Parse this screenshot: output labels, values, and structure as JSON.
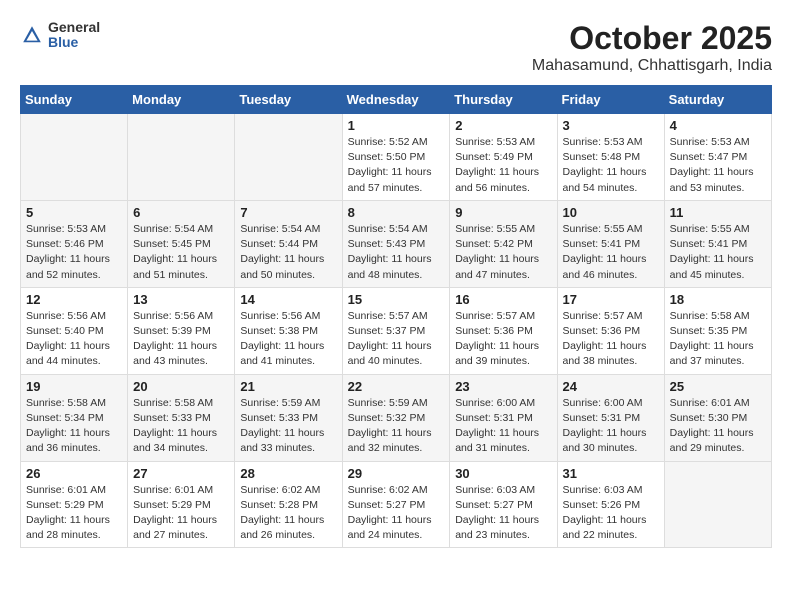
{
  "header": {
    "logo_general": "General",
    "logo_blue": "Blue",
    "month": "October 2025",
    "location": "Mahasamund, Chhattisgarh, India"
  },
  "weekdays": [
    "Sunday",
    "Monday",
    "Tuesday",
    "Wednesday",
    "Thursday",
    "Friday",
    "Saturday"
  ],
  "weeks": [
    [
      {
        "day": "",
        "info": ""
      },
      {
        "day": "",
        "info": ""
      },
      {
        "day": "",
        "info": ""
      },
      {
        "day": "1",
        "info": "Sunrise: 5:52 AM\nSunset: 5:50 PM\nDaylight: 11 hours and 57 minutes."
      },
      {
        "day": "2",
        "info": "Sunrise: 5:53 AM\nSunset: 5:49 PM\nDaylight: 11 hours and 56 minutes."
      },
      {
        "day": "3",
        "info": "Sunrise: 5:53 AM\nSunset: 5:48 PM\nDaylight: 11 hours and 54 minutes."
      },
      {
        "day": "4",
        "info": "Sunrise: 5:53 AM\nSunset: 5:47 PM\nDaylight: 11 hours and 53 minutes."
      }
    ],
    [
      {
        "day": "5",
        "info": "Sunrise: 5:53 AM\nSunset: 5:46 PM\nDaylight: 11 hours and 52 minutes."
      },
      {
        "day": "6",
        "info": "Sunrise: 5:54 AM\nSunset: 5:45 PM\nDaylight: 11 hours and 51 minutes."
      },
      {
        "day": "7",
        "info": "Sunrise: 5:54 AM\nSunset: 5:44 PM\nDaylight: 11 hours and 50 minutes."
      },
      {
        "day": "8",
        "info": "Sunrise: 5:54 AM\nSunset: 5:43 PM\nDaylight: 11 hours and 48 minutes."
      },
      {
        "day": "9",
        "info": "Sunrise: 5:55 AM\nSunset: 5:42 PM\nDaylight: 11 hours and 47 minutes."
      },
      {
        "day": "10",
        "info": "Sunrise: 5:55 AM\nSunset: 5:41 PM\nDaylight: 11 hours and 46 minutes."
      },
      {
        "day": "11",
        "info": "Sunrise: 5:55 AM\nSunset: 5:41 PM\nDaylight: 11 hours and 45 minutes."
      }
    ],
    [
      {
        "day": "12",
        "info": "Sunrise: 5:56 AM\nSunset: 5:40 PM\nDaylight: 11 hours and 44 minutes."
      },
      {
        "day": "13",
        "info": "Sunrise: 5:56 AM\nSunset: 5:39 PM\nDaylight: 11 hours and 43 minutes."
      },
      {
        "day": "14",
        "info": "Sunrise: 5:56 AM\nSunset: 5:38 PM\nDaylight: 11 hours and 41 minutes."
      },
      {
        "day": "15",
        "info": "Sunrise: 5:57 AM\nSunset: 5:37 PM\nDaylight: 11 hours and 40 minutes."
      },
      {
        "day": "16",
        "info": "Sunrise: 5:57 AM\nSunset: 5:36 PM\nDaylight: 11 hours and 39 minutes."
      },
      {
        "day": "17",
        "info": "Sunrise: 5:57 AM\nSunset: 5:36 PM\nDaylight: 11 hours and 38 minutes."
      },
      {
        "day": "18",
        "info": "Sunrise: 5:58 AM\nSunset: 5:35 PM\nDaylight: 11 hours and 37 minutes."
      }
    ],
    [
      {
        "day": "19",
        "info": "Sunrise: 5:58 AM\nSunset: 5:34 PM\nDaylight: 11 hours and 36 minutes."
      },
      {
        "day": "20",
        "info": "Sunrise: 5:58 AM\nSunset: 5:33 PM\nDaylight: 11 hours and 34 minutes."
      },
      {
        "day": "21",
        "info": "Sunrise: 5:59 AM\nSunset: 5:33 PM\nDaylight: 11 hours and 33 minutes."
      },
      {
        "day": "22",
        "info": "Sunrise: 5:59 AM\nSunset: 5:32 PM\nDaylight: 11 hours and 32 minutes."
      },
      {
        "day": "23",
        "info": "Sunrise: 6:00 AM\nSunset: 5:31 PM\nDaylight: 11 hours and 31 minutes."
      },
      {
        "day": "24",
        "info": "Sunrise: 6:00 AM\nSunset: 5:31 PM\nDaylight: 11 hours and 30 minutes."
      },
      {
        "day": "25",
        "info": "Sunrise: 6:01 AM\nSunset: 5:30 PM\nDaylight: 11 hours and 29 minutes."
      }
    ],
    [
      {
        "day": "26",
        "info": "Sunrise: 6:01 AM\nSunset: 5:29 PM\nDaylight: 11 hours and 28 minutes."
      },
      {
        "day": "27",
        "info": "Sunrise: 6:01 AM\nSunset: 5:29 PM\nDaylight: 11 hours and 27 minutes."
      },
      {
        "day": "28",
        "info": "Sunrise: 6:02 AM\nSunset: 5:28 PM\nDaylight: 11 hours and 26 minutes."
      },
      {
        "day": "29",
        "info": "Sunrise: 6:02 AM\nSunset: 5:27 PM\nDaylight: 11 hours and 24 minutes."
      },
      {
        "day": "30",
        "info": "Sunrise: 6:03 AM\nSunset: 5:27 PM\nDaylight: 11 hours and 23 minutes."
      },
      {
        "day": "31",
        "info": "Sunrise: 6:03 AM\nSunset: 5:26 PM\nDaylight: 11 hours and 22 minutes."
      },
      {
        "day": "",
        "info": ""
      }
    ]
  ]
}
